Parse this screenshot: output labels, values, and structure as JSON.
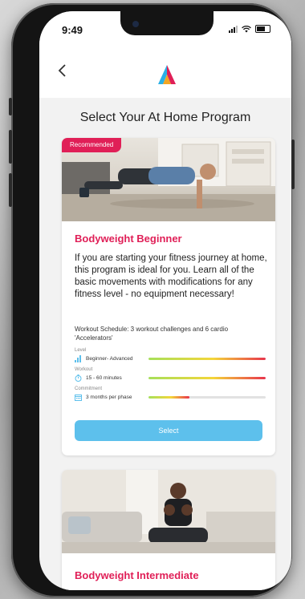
{
  "status_bar": {
    "time": "9:49"
  },
  "page": {
    "title": "Select Your At Home Program"
  },
  "programs": [
    {
      "badge": "Recommended",
      "title": "Bodyweight Beginner",
      "description": "If you are starting your fitness journey at home, this program is ideal for you. Learn all of the basic movements with modifications for any fitness level - no equipment necessary!",
      "schedule": "Workout Schedule: 3 workout challenges and 6 cardio 'Accelerators'",
      "metrics": [
        {
          "label": "Level",
          "value": "Beginner- Advanced",
          "icon": "level-icon",
          "fill_percent": 100
        },
        {
          "label": "Workout",
          "value": "15 - 60 minutes",
          "icon": "timer-icon",
          "fill_percent": 100
        },
        {
          "label": "Commitment",
          "value": "3 months per phase",
          "icon": "calendar-icon",
          "fill_percent": 35
        }
      ],
      "select_label": "Select"
    },
    {
      "title": "Bodyweight Intermediate"
    }
  ],
  "colors": {
    "accent": "#e01f57",
    "button": "#5dc0ec",
    "background": "#f2f2f2"
  }
}
